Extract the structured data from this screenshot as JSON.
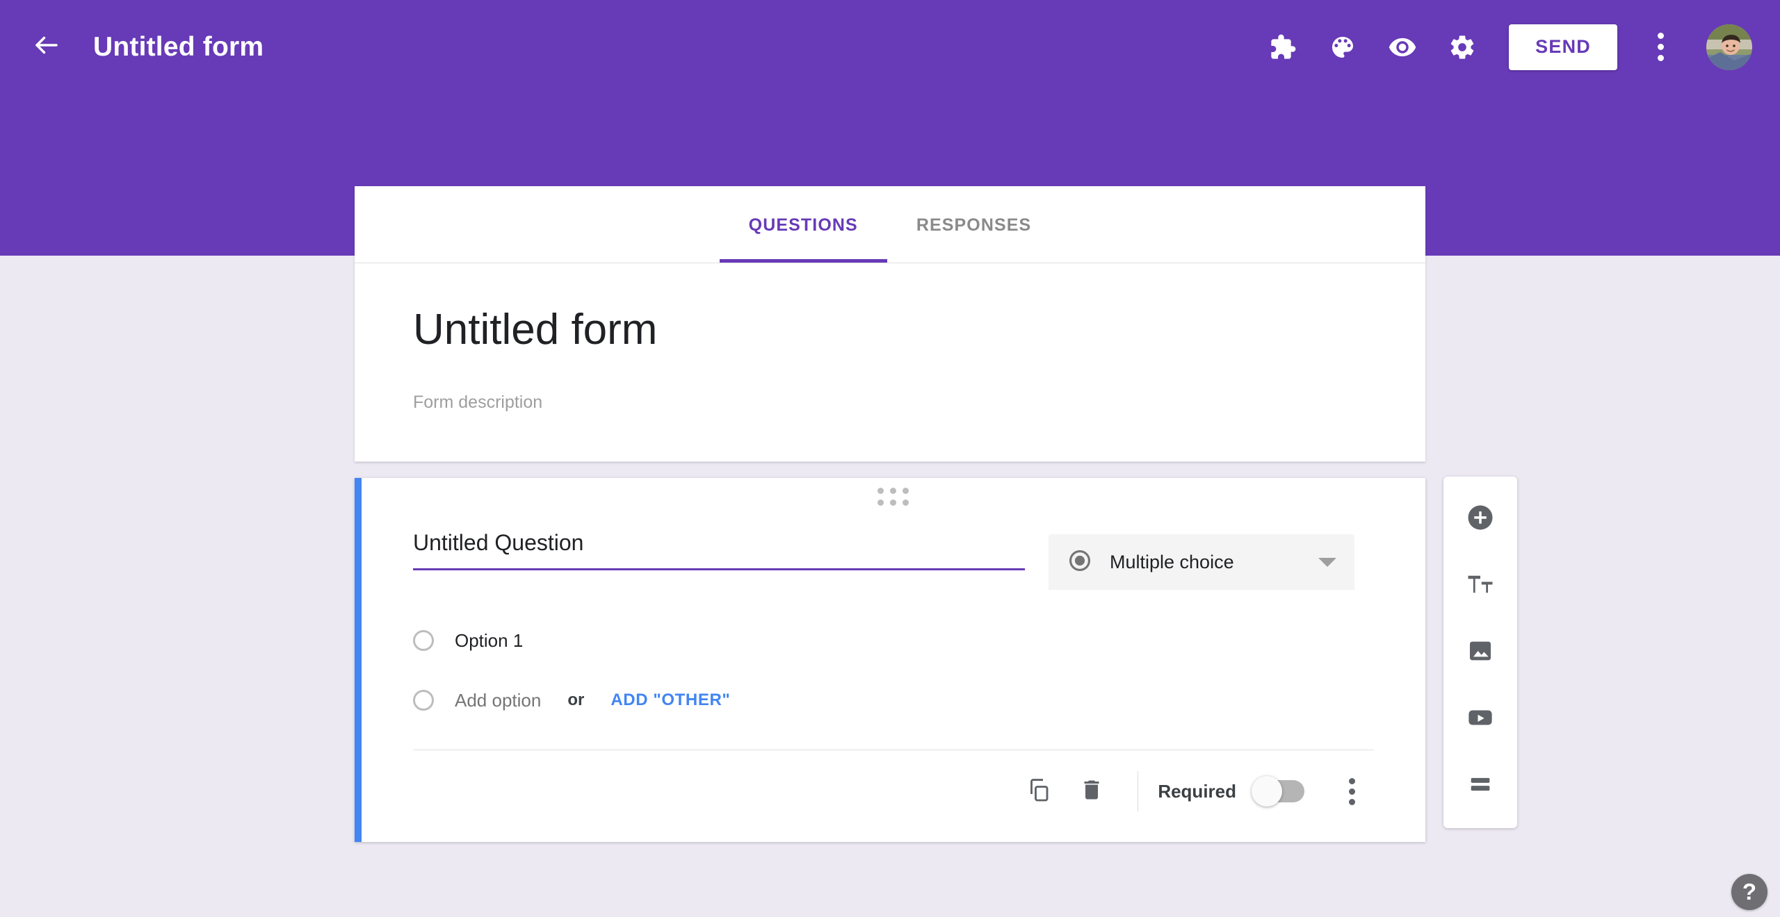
{
  "appbar": {
    "back_icon": "arrow-left-icon",
    "title": "Untitled form",
    "actions": [
      {
        "icon": "puzzle-piece-icon",
        "name": "add-ons-button"
      },
      {
        "icon": "palette-icon",
        "name": "theme-button"
      },
      {
        "icon": "eye-icon",
        "name": "preview-button"
      },
      {
        "icon": "gear-icon",
        "name": "settings-button"
      }
    ],
    "send_label": "SEND",
    "overflow_icon": "more-vert-icon",
    "avatar_label": "account-avatar",
    "bg_color": "#673ab7",
    "send_text_color": "#673ab7"
  },
  "tabs": [
    {
      "label": "QUESTIONS",
      "active": true
    },
    {
      "label": "RESPONSES",
      "active": false
    }
  ],
  "form": {
    "title": "Untitled form",
    "description_placeholder": "Form description"
  },
  "question": {
    "drag_handle_icon": "drag-grip-icon",
    "title": "Untitled Question",
    "type": {
      "icon": "radio-filled-icon",
      "label": "Multiple choice",
      "caret_icon": "chevron-down-icon"
    },
    "options": [
      {
        "radio_icon": "radio-empty-icon",
        "label": "Option 1"
      }
    ],
    "add_option": {
      "radio_icon": "radio-empty-icon",
      "label": "Add option",
      "or": "or",
      "add_other_label": "ADD \"OTHER\"",
      "link_color": "#4285f4"
    },
    "footer": {
      "duplicate_icon": "duplicate-icon",
      "delete_icon": "trash-icon",
      "required_label": "Required",
      "required_on": false,
      "overflow_icon": "more-vert-icon"
    },
    "accent_color": "#4285f4"
  },
  "side_toolbar": [
    {
      "icon": "add-circle-icon",
      "name": "add-question-button"
    },
    {
      "icon": "title-text-icon",
      "name": "add-title-button"
    },
    {
      "icon": "image-icon",
      "name": "add-image-button"
    },
    {
      "icon": "video-icon",
      "name": "add-video-button"
    },
    {
      "icon": "section-icon",
      "name": "add-section-button"
    }
  ],
  "help": {
    "label": "?"
  },
  "page": {
    "bg_color": "#ece9f3"
  }
}
